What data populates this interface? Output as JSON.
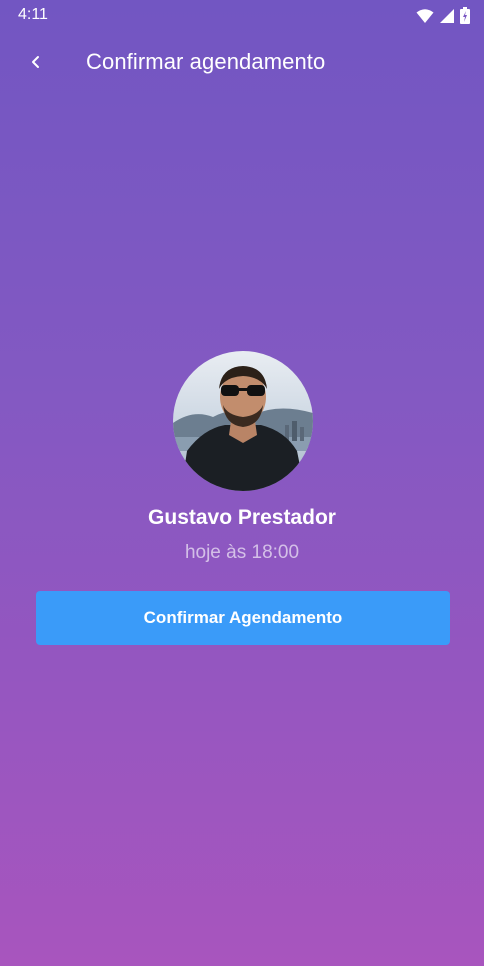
{
  "status_bar": {
    "time": "4:11",
    "icons": [
      "wifi-icon",
      "signal-icon",
      "battery-icon"
    ]
  },
  "toolbar": {
    "back_icon": "chevron-left-icon",
    "title": "Confirmar agendamento"
  },
  "provider": {
    "avatar_icon": "profile-photo",
    "name": "Gustavo Prestador",
    "schedule": "hoje às 18:00"
  },
  "actions": {
    "confirm_label": "Confirmar Agendamento"
  },
  "colors": {
    "gradient_top": "#7256C2",
    "gradient_bottom": "#A855BE",
    "button": "#3A9BF9",
    "text_primary": "#FFFFFF"
  }
}
